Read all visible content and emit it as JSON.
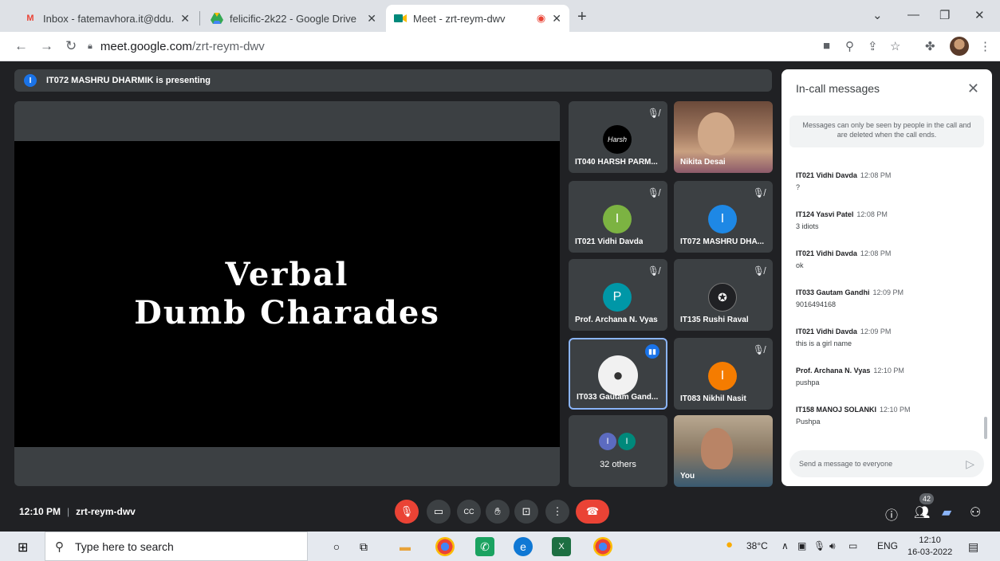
{
  "browser": {
    "tabs": [
      {
        "title": "Inbox - fatemavhora.it@ddu.ac.in",
        "favicon": "gmail-icon"
      },
      {
        "title": "felicific-2k22 - Google Drive",
        "favicon": "drive-icon"
      },
      {
        "title": "Meet - zrt-reym-dwv",
        "favicon": "meet-icon"
      }
    ],
    "url_host": "meet.google.com",
    "url_path": "/zrt-reym-dwv"
  },
  "meet": {
    "presenting_banner": "IT072 MASHRU DHARMIK is presenting",
    "presenter_initial": "I",
    "slide": {
      "line1": "Verbal",
      "line2": "Dumb Charades"
    },
    "participants": [
      {
        "name": "IT040 HARSH PARM...",
        "avatar": "logo",
        "muted": true
      },
      {
        "name": "Nikita Desai",
        "avatar": "video",
        "muted": false
      },
      {
        "name": "IT021 Vidhi Davda",
        "avatar": "I",
        "color": "#7cb342",
        "muted": true
      },
      {
        "name": "IT072 MASHRU DHA...",
        "avatar": "I",
        "color": "#1e88e5",
        "muted": true
      },
      {
        "name": "Prof. Archana N. Vyas",
        "avatar": "P",
        "color": "#0097a7",
        "muted": true
      },
      {
        "name": "IT135 Rushi Raval",
        "avatar": "logo",
        "muted": true
      },
      {
        "name": "IT033 Gautam Gand...",
        "avatar": "photo",
        "speaking": true
      },
      {
        "name": "IT083 Nikhil Nasit",
        "avatar": "I",
        "color": "#f57c00",
        "muted": true
      },
      {
        "name": "32 others",
        "avatar": "group"
      },
      {
        "name": "You",
        "avatar": "video"
      }
    ],
    "time": "12:10 PM",
    "meeting_code": "zrt-reym-dwv",
    "people_count": "42"
  },
  "chat": {
    "title": "In-call messages",
    "notice": "Messages can only be seen by people in the call and are deleted when the call ends.",
    "messages": [
      {
        "author": "IT021 Vidhi Davda",
        "time": "12:08 PM",
        "text": "?"
      },
      {
        "author": "IT124 Yasvi Patel",
        "time": "12:08 PM",
        "text": "3 idiots"
      },
      {
        "author": "IT021 Vidhi Davda",
        "time": "12:08 PM",
        "text": "ok"
      },
      {
        "author": "IT033 Gautam Gandhi",
        "time": "12:09 PM",
        "text": "9016494168"
      },
      {
        "author": "IT021 Vidhi Davda",
        "time": "12:09 PM",
        "text": "this is a girl name"
      },
      {
        "author": "Prof. Archana N. Vyas",
        "time": "12:10 PM",
        "text": "pushpa"
      },
      {
        "author": "IT158 MANOJ SOLANKI",
        "time": "12:10 PM",
        "text": "Pushpa"
      }
    ],
    "input_placeholder": "Send a message to everyone"
  },
  "taskbar": {
    "search_placeholder": "Type here to search",
    "weather": "38°C",
    "language": "ENG",
    "time": "12:10",
    "date": "16-03-2022"
  }
}
